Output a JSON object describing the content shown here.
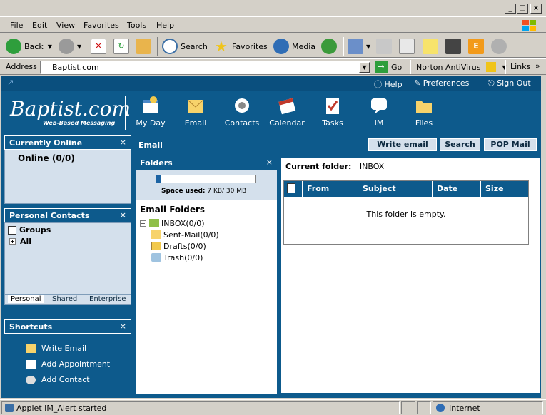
{
  "menubar": {
    "items": [
      "File",
      "Edit",
      "View",
      "Favorites",
      "Tools",
      "Help"
    ]
  },
  "toolbar": {
    "back_label": "Back",
    "search_label": "Search",
    "favorites_label": "Favorites",
    "media_label": "Media"
  },
  "addressbar": {
    "label": "Address",
    "url": "Baptist.com",
    "go_label": "Go",
    "norton_label": "Norton AntiVirus",
    "links_label": "Links"
  },
  "app": {
    "top_links": {
      "help": "Help",
      "preferences": "Preferences",
      "signout": "Sign Out"
    },
    "logo_text": "Baptist.com",
    "logo_sub": "Web-Based Messaging",
    "nav": [
      {
        "label": "My Day",
        "icon": "my-day-icon"
      },
      {
        "label": "Email",
        "icon": "email-icon"
      },
      {
        "label": "Contacts",
        "icon": "contacts-icon"
      },
      {
        "label": "Calendar",
        "icon": "calendar-icon"
      },
      {
        "label": "Tasks",
        "icon": "tasks-icon"
      },
      {
        "label": "IM",
        "icon": "im-icon"
      },
      {
        "label": "Files",
        "icon": "files-icon"
      }
    ],
    "online_panel": {
      "title": "Currently Online",
      "status": "Online (0/0)"
    },
    "contacts_panel": {
      "title": "Personal Contacts",
      "groups_label": "Groups",
      "all_label": "All",
      "tabs": [
        "Personal",
        "Shared",
        "Enterprise"
      ]
    },
    "shortcuts_panel": {
      "title": "Shortcuts",
      "items": [
        "Write Email",
        "Add Appointment",
        "Add Contact"
      ]
    },
    "email": {
      "title": "Email",
      "write_button": "Write email",
      "search_button": "Search",
      "pop_button": "POP Mail"
    },
    "folders": {
      "title": "Folders",
      "space_used_label": "Space used:",
      "space_used_value": "7 KB/ 30 MB",
      "quota_fraction": 0.04,
      "section_title": "Email Folders",
      "items": [
        "INBOX(0/0)",
        "Sent-Mail(0/0)",
        "Drafts(0/0)",
        "Trash(0/0)"
      ]
    },
    "content": {
      "current_folder_label": "Current folder:",
      "current_folder_value": "INBOX",
      "columns": [
        "From",
        "Subject",
        "Date",
        "Size"
      ],
      "empty_message": "This folder is empty."
    }
  },
  "statusbar": {
    "message": "Applet IM_Alert started",
    "zone": "Internet"
  },
  "colors": {
    "app_blue": "#0d5a8c",
    "panel_bg": "#d4e0ec"
  }
}
